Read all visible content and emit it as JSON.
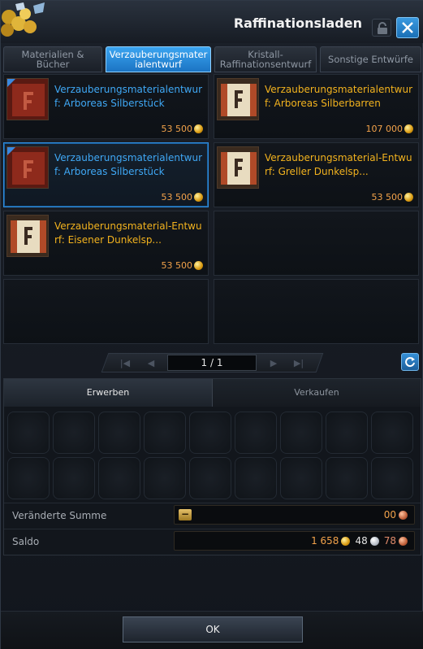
{
  "window": {
    "title": "Raffinationsladen"
  },
  "tabs": [
    {
      "label": "Materialien & Bücher",
      "active": false
    },
    {
      "label": "Verzauberungsmaterialentwurf",
      "active": true
    },
    {
      "label": "Kristall-Raffinationsentwurf",
      "active": false
    },
    {
      "label": "Sonstige Entwürfe",
      "active": false
    }
  ],
  "items": [
    {
      "name": "Verzauberungsmaterialentwurf: Arboreas Silberstück",
      "price": "53 500",
      "name_color": "blue",
      "icon": "red-recipe-book-icon",
      "flag": true,
      "selected": false
    },
    {
      "name": "Verzauberungsmaterialentwurf: Arboreas Silberbarren",
      "price": "107 000",
      "name_color": "gold",
      "icon": "scroll-recipe-icon",
      "flag": false,
      "selected": false
    },
    {
      "name": "Verzauberungsmaterialentwurf: Arboreas Silberstück",
      "price": "53 500",
      "name_color": "blue",
      "icon": "red-recipe-book-icon",
      "flag": true,
      "selected": true
    },
    {
      "name": "Verzauberungsmaterial-Entwurf: Greller Dunkelsp...",
      "price": "53 500",
      "name_color": "gold",
      "icon": "scroll-recipe-icon",
      "flag": false,
      "selected": false
    },
    {
      "name": "Verzauberungsmaterial-Entwurf: Eisener Dunkelsp...",
      "price": "53 500",
      "name_color": "gold",
      "icon": "scroll-recipe-icon",
      "flag": false,
      "selected": false
    }
  ],
  "pager": {
    "page": "1 / 1"
  },
  "trade": {
    "buy_label": "Erwerben",
    "sell_label": "Verkaufen",
    "changed_sum_label": "Veränderte Summe",
    "changed_sum_value": "00",
    "balance_label": "Saldo",
    "balance_gold": "1 658",
    "balance_silver": "48",
    "balance_copper": "78"
  },
  "footer": {
    "ok_label": "OK"
  },
  "colors": {
    "accent": "#2f8ee0",
    "item_blue": "#3fa8f5",
    "item_gold": "#f2b21e",
    "price": "#f2a24a"
  }
}
